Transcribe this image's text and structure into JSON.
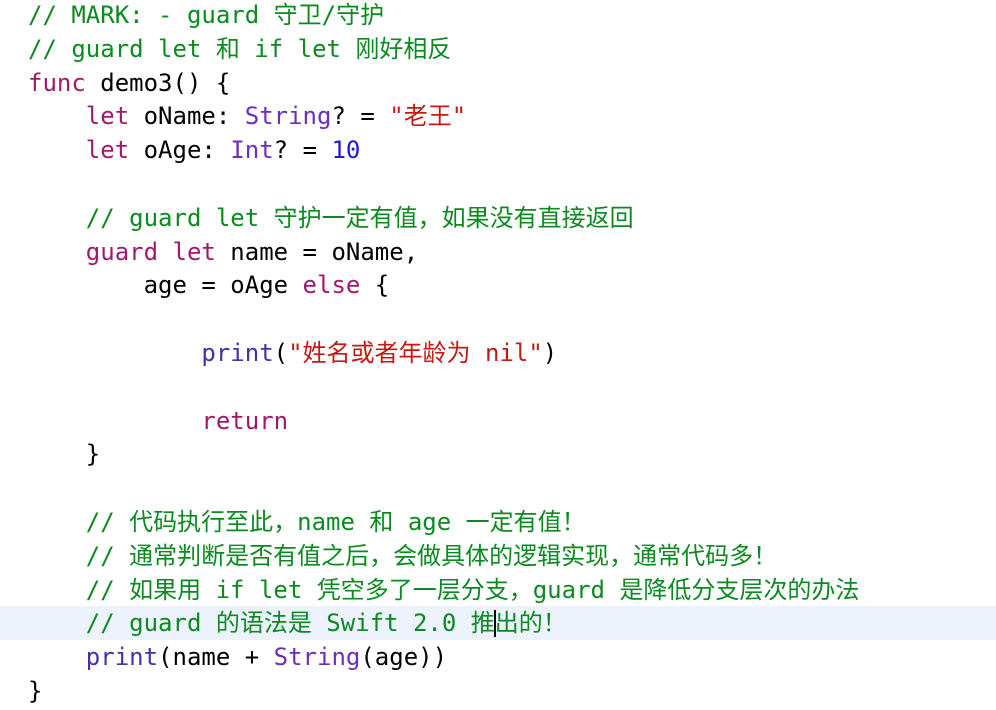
{
  "editor": {
    "lines": [
      [
        {
          "t": "// MARK: - guard 守卫/守护",
          "k": "comment"
        }
      ],
      [
        {
          "t": "// guard let 和 if let 刚好相反",
          "k": "comment"
        }
      ],
      [
        {
          "t": "func",
          "k": "keyword"
        },
        {
          "t": " demo3() {",
          "k": "plain"
        }
      ],
      [
        {
          "t": "    ",
          "k": "plain"
        },
        {
          "t": "let",
          "k": "keyword"
        },
        {
          "t": " oName: ",
          "k": "plain"
        },
        {
          "t": "String",
          "k": "type"
        },
        {
          "t": "? = ",
          "k": "plain"
        },
        {
          "t": "\"老王\"",
          "k": "string"
        }
      ],
      [
        {
          "t": "    ",
          "k": "plain"
        },
        {
          "t": "let",
          "k": "keyword"
        },
        {
          "t": " oAge: ",
          "k": "plain"
        },
        {
          "t": "Int",
          "k": "type"
        },
        {
          "t": "? = ",
          "k": "plain"
        },
        {
          "t": "10",
          "k": "number"
        }
      ],
      [],
      [
        {
          "t": "    ",
          "k": "plain"
        },
        {
          "t": "// guard let 守护一定有值，如果没有直接返回",
          "k": "comment"
        }
      ],
      [
        {
          "t": "    ",
          "k": "plain"
        },
        {
          "t": "guard",
          "k": "keyword"
        },
        {
          "t": " ",
          "k": "plain"
        },
        {
          "t": "let",
          "k": "keyword"
        },
        {
          "t": " name = oName,",
          "k": "plain"
        }
      ],
      [
        {
          "t": "        age = oAge ",
          "k": "plain"
        },
        {
          "t": "else",
          "k": "keyword"
        },
        {
          "t": " {",
          "k": "plain"
        }
      ],
      [],
      [
        {
          "t": "            ",
          "k": "plain"
        },
        {
          "t": "print",
          "k": "func"
        },
        {
          "t": "(",
          "k": "plain"
        },
        {
          "t": "\"姓名或者年龄为 nil\"",
          "k": "string"
        },
        {
          "t": ")",
          "k": "plain"
        }
      ],
      [],
      [
        {
          "t": "            ",
          "k": "plain"
        },
        {
          "t": "return",
          "k": "keyword"
        }
      ],
      [
        {
          "t": "    }",
          "k": "plain"
        }
      ],
      [],
      [
        {
          "t": "    ",
          "k": "plain"
        },
        {
          "t": "// 代码执行至此，name 和 age 一定有值！",
          "k": "comment"
        }
      ],
      [
        {
          "t": "    ",
          "k": "plain"
        },
        {
          "t": "// 通常判断是否有值之后，会做具体的逻辑实现，通常代码多！",
          "k": "comment"
        }
      ],
      [
        {
          "t": "    ",
          "k": "plain"
        },
        {
          "t": "// 如果用 if let 凭空多了一层分支，guard 是降低分支层次的办法",
          "k": "comment"
        }
      ],
      [
        {
          "t": "    ",
          "k": "plain"
        },
        {
          "t": "// guard 的语法是 Swift 2.0 推",
          "k": "comment"
        },
        {
          "caret": true
        },
        {
          "t": "出的！",
          "k": "comment"
        }
      ],
      [
        {
          "t": "    ",
          "k": "plain"
        },
        {
          "t": "print",
          "k": "func"
        },
        {
          "t": "(name + ",
          "k": "plain"
        },
        {
          "t": "String",
          "k": "type"
        },
        {
          "t": "(age))",
          "k": "plain"
        }
      ],
      [
        {
          "t": "}",
          "k": "plain"
        }
      ]
    ]
  }
}
